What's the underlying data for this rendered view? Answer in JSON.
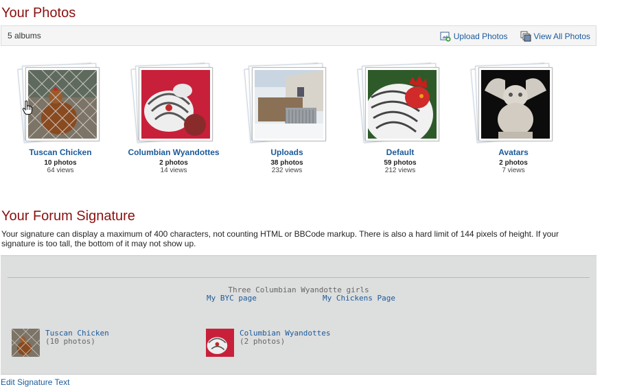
{
  "photos_section": {
    "title": "Your Photos",
    "albums_count": "5 albums",
    "upload_label": "Upload Photos",
    "view_all_label": "View All Photos",
    "albums": [
      {
        "title": "Tuscan Chicken",
        "count": "10 photos",
        "views": "64 views",
        "thumb": "hen-behind-fence"
      },
      {
        "title": "Columbian Wyandottes",
        "count": "2 photos",
        "views": "14 views",
        "thumb": "chickens-under-heat-lamp"
      },
      {
        "title": "Uploads",
        "count": "38 photos",
        "views": "232 views",
        "thumb": "coop-in-snow"
      },
      {
        "title": "Default",
        "count": "59 photos",
        "views": "212 views",
        "thumb": "rooster-closeup"
      },
      {
        "title": "Avatars",
        "count": "2 photos",
        "views": "7 views",
        "thumb": "gargoyle-statue"
      }
    ]
  },
  "signature_section": {
    "title": "Your Forum Signature",
    "description": "Your signature can display a maximum of 400 characters, not counting HTML or BBCode markup. There is also a hard limit of 144 pixels of height. If your signature is too tall, the bottom of it may not show up.",
    "preview": {
      "caption": "Three Columbian Wyandotte girls",
      "link_byc": "My BYC page",
      "link_chickens": "My Chickens Page",
      "albums": [
        {
          "title": "Tuscan Chicken",
          "count": "(10 photos)"
        },
        {
          "title": "Columbian Wyandottes",
          "count": "(2 photos)"
        }
      ]
    },
    "edit_label": "Edit Signature Text"
  }
}
